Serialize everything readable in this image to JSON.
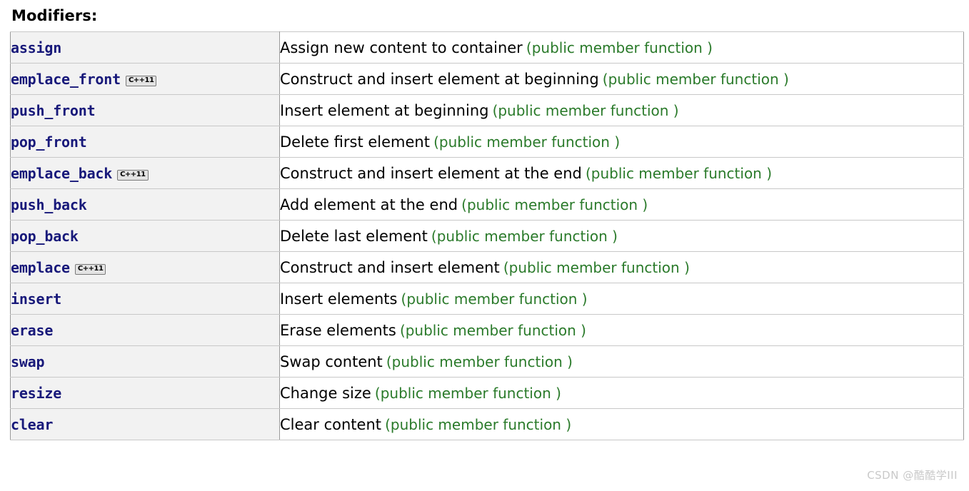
{
  "page": {
    "section_heading": "Modifiers:",
    "watermark": "CSDN @酷酷学III"
  },
  "table": {
    "rows": [
      {
        "name": "assign",
        "badge": "",
        "description": "Assign new content to container",
        "kind": "(public member function )"
      },
      {
        "name": "emplace_front",
        "badge": "C++11",
        "description": "Construct and insert element at beginning",
        "kind": "(public member function )"
      },
      {
        "name": "push_front",
        "badge": "",
        "description": "Insert element at beginning",
        "kind": "(public member function )"
      },
      {
        "name": "pop_front",
        "badge": "",
        "description": "Delete first element",
        "kind": "(public member function )"
      },
      {
        "name": "emplace_back",
        "badge": "C++11",
        "description": "Construct and insert element at the end",
        "kind": "(public member function )"
      },
      {
        "name": "push_back",
        "badge": "",
        "description": "Add element at the end",
        "kind": "(public member function )"
      },
      {
        "name": "pop_back",
        "badge": "",
        "description": "Delete last element",
        "kind": "(public member function )"
      },
      {
        "name": "emplace",
        "badge": "C++11",
        "description": "Construct and insert element",
        "kind": "(public member function )"
      },
      {
        "name": "insert",
        "badge": "",
        "description": "Insert elements",
        "kind": "(public member function )"
      },
      {
        "name": "erase",
        "badge": "",
        "description": "Erase elements",
        "kind": "(public member function )"
      },
      {
        "name": "swap",
        "badge": "",
        "description": "Swap content",
        "kind": "(public member function )"
      },
      {
        "name": "resize",
        "badge": "",
        "description": "Change size",
        "kind": "(public member function )"
      },
      {
        "name": "clear",
        "badge": "",
        "description": "Clear content",
        "kind": "(public member function )"
      }
    ]
  }
}
